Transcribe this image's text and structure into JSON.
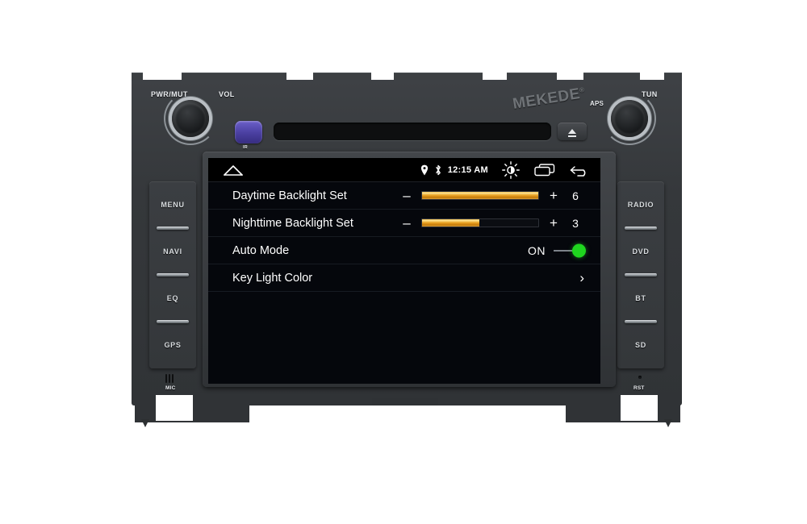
{
  "device": {
    "brand": "MEKEDE",
    "brand_registered": "®",
    "top_labels": {
      "power_mute": "PWR/MUT",
      "volume": "VOL",
      "ir": "IR",
      "aps": "APS",
      "tune": "TUN"
    },
    "left_buttons": [
      {
        "label": "MENU",
        "name": "menu"
      },
      {
        "label": "NAVI",
        "name": "navi"
      },
      {
        "label": "EQ",
        "name": "eq"
      },
      {
        "label": "GPS",
        "name": "gps"
      }
    ],
    "right_buttons": [
      {
        "label": "RADIO",
        "name": "radio"
      },
      {
        "label": "DVD",
        "name": "dvd"
      },
      {
        "label": "BT",
        "name": "bt"
      },
      {
        "label": "SD",
        "name": "sd"
      }
    ],
    "bottom_labels": {
      "mic": "MIC",
      "reset": "RST"
    }
  },
  "statusbar": {
    "home_icon": "home-icon",
    "location_icon": "location-pin-icon",
    "bluetooth_icon": "bluetooth-icon",
    "time": "12:15 AM",
    "brightness_icon": "brightness-sun-icon",
    "recents_icon": "recent-apps-icon",
    "back_icon": "back-arrow-icon"
  },
  "settings": {
    "rows": [
      {
        "label": "Daytime Backlight Set",
        "type": "slider",
        "minus": "–",
        "plus": "+",
        "value": "6",
        "fill_percent": 100
      },
      {
        "label": "Nighttime Backlight Set",
        "type": "slider",
        "minus": "–",
        "plus": "+",
        "value": "3",
        "fill_percent": 49
      },
      {
        "label": "Auto Mode",
        "type": "toggle",
        "state": "ON"
      },
      {
        "label": "Key Light Color",
        "type": "navigate",
        "chevron": "›"
      }
    ]
  },
  "colors": {
    "accent_slider": "#e8a531",
    "toggle_on": "#1fd61f",
    "screen_bg": "#05070c",
    "chassis": "#35383b",
    "ir_sensor": "#4a3fa0"
  }
}
